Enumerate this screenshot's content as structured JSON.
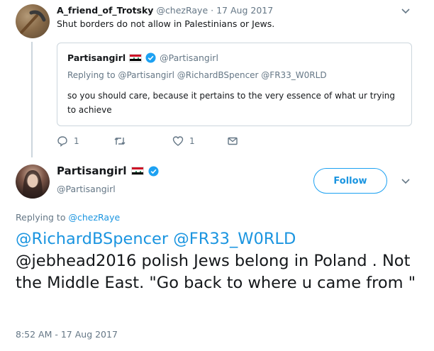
{
  "parent_tweet": {
    "display_name": "A_friend_of_Trotsky",
    "handle": "@chezRaye",
    "separator": "·",
    "date": "17 Aug 2017",
    "text": "Shut borders do not allow in Palestinians or Jews.",
    "avatar_icon": "avatar-icon",
    "actions": {
      "reply_count": "1",
      "retweet_count": "",
      "like_count": "1"
    }
  },
  "quoted_tweet": {
    "display_name": "Partisangirl",
    "handle": "@Partisangirl",
    "replying_to_prefix": "Replying to",
    "replying_to": "@Partisangirl @RichardBSpencer @FR33_W0RLD",
    "text": "so you should care, because it pertains to the very essence of what ur trying to achieve"
  },
  "main_tweet": {
    "display_name": "Partisangirl",
    "handle": "@Partisangirl",
    "follow_label": "Follow",
    "replying_to_prefix": "Replying to",
    "replying_to": "@chezRaye",
    "mentions": "@RichardBSpencer @FR33_W0RLD",
    "text": "@jebhead2016 polish Jews belong in Poland . Not the Middle East. \"Go back to where u came from \"",
    "timestamp": "8:52 AM - 17 Aug 2017"
  },
  "colors": {
    "link": "#1b95e0",
    "muted": "#657786",
    "verified": "#1da1f2",
    "border": "#ccd6dd"
  }
}
